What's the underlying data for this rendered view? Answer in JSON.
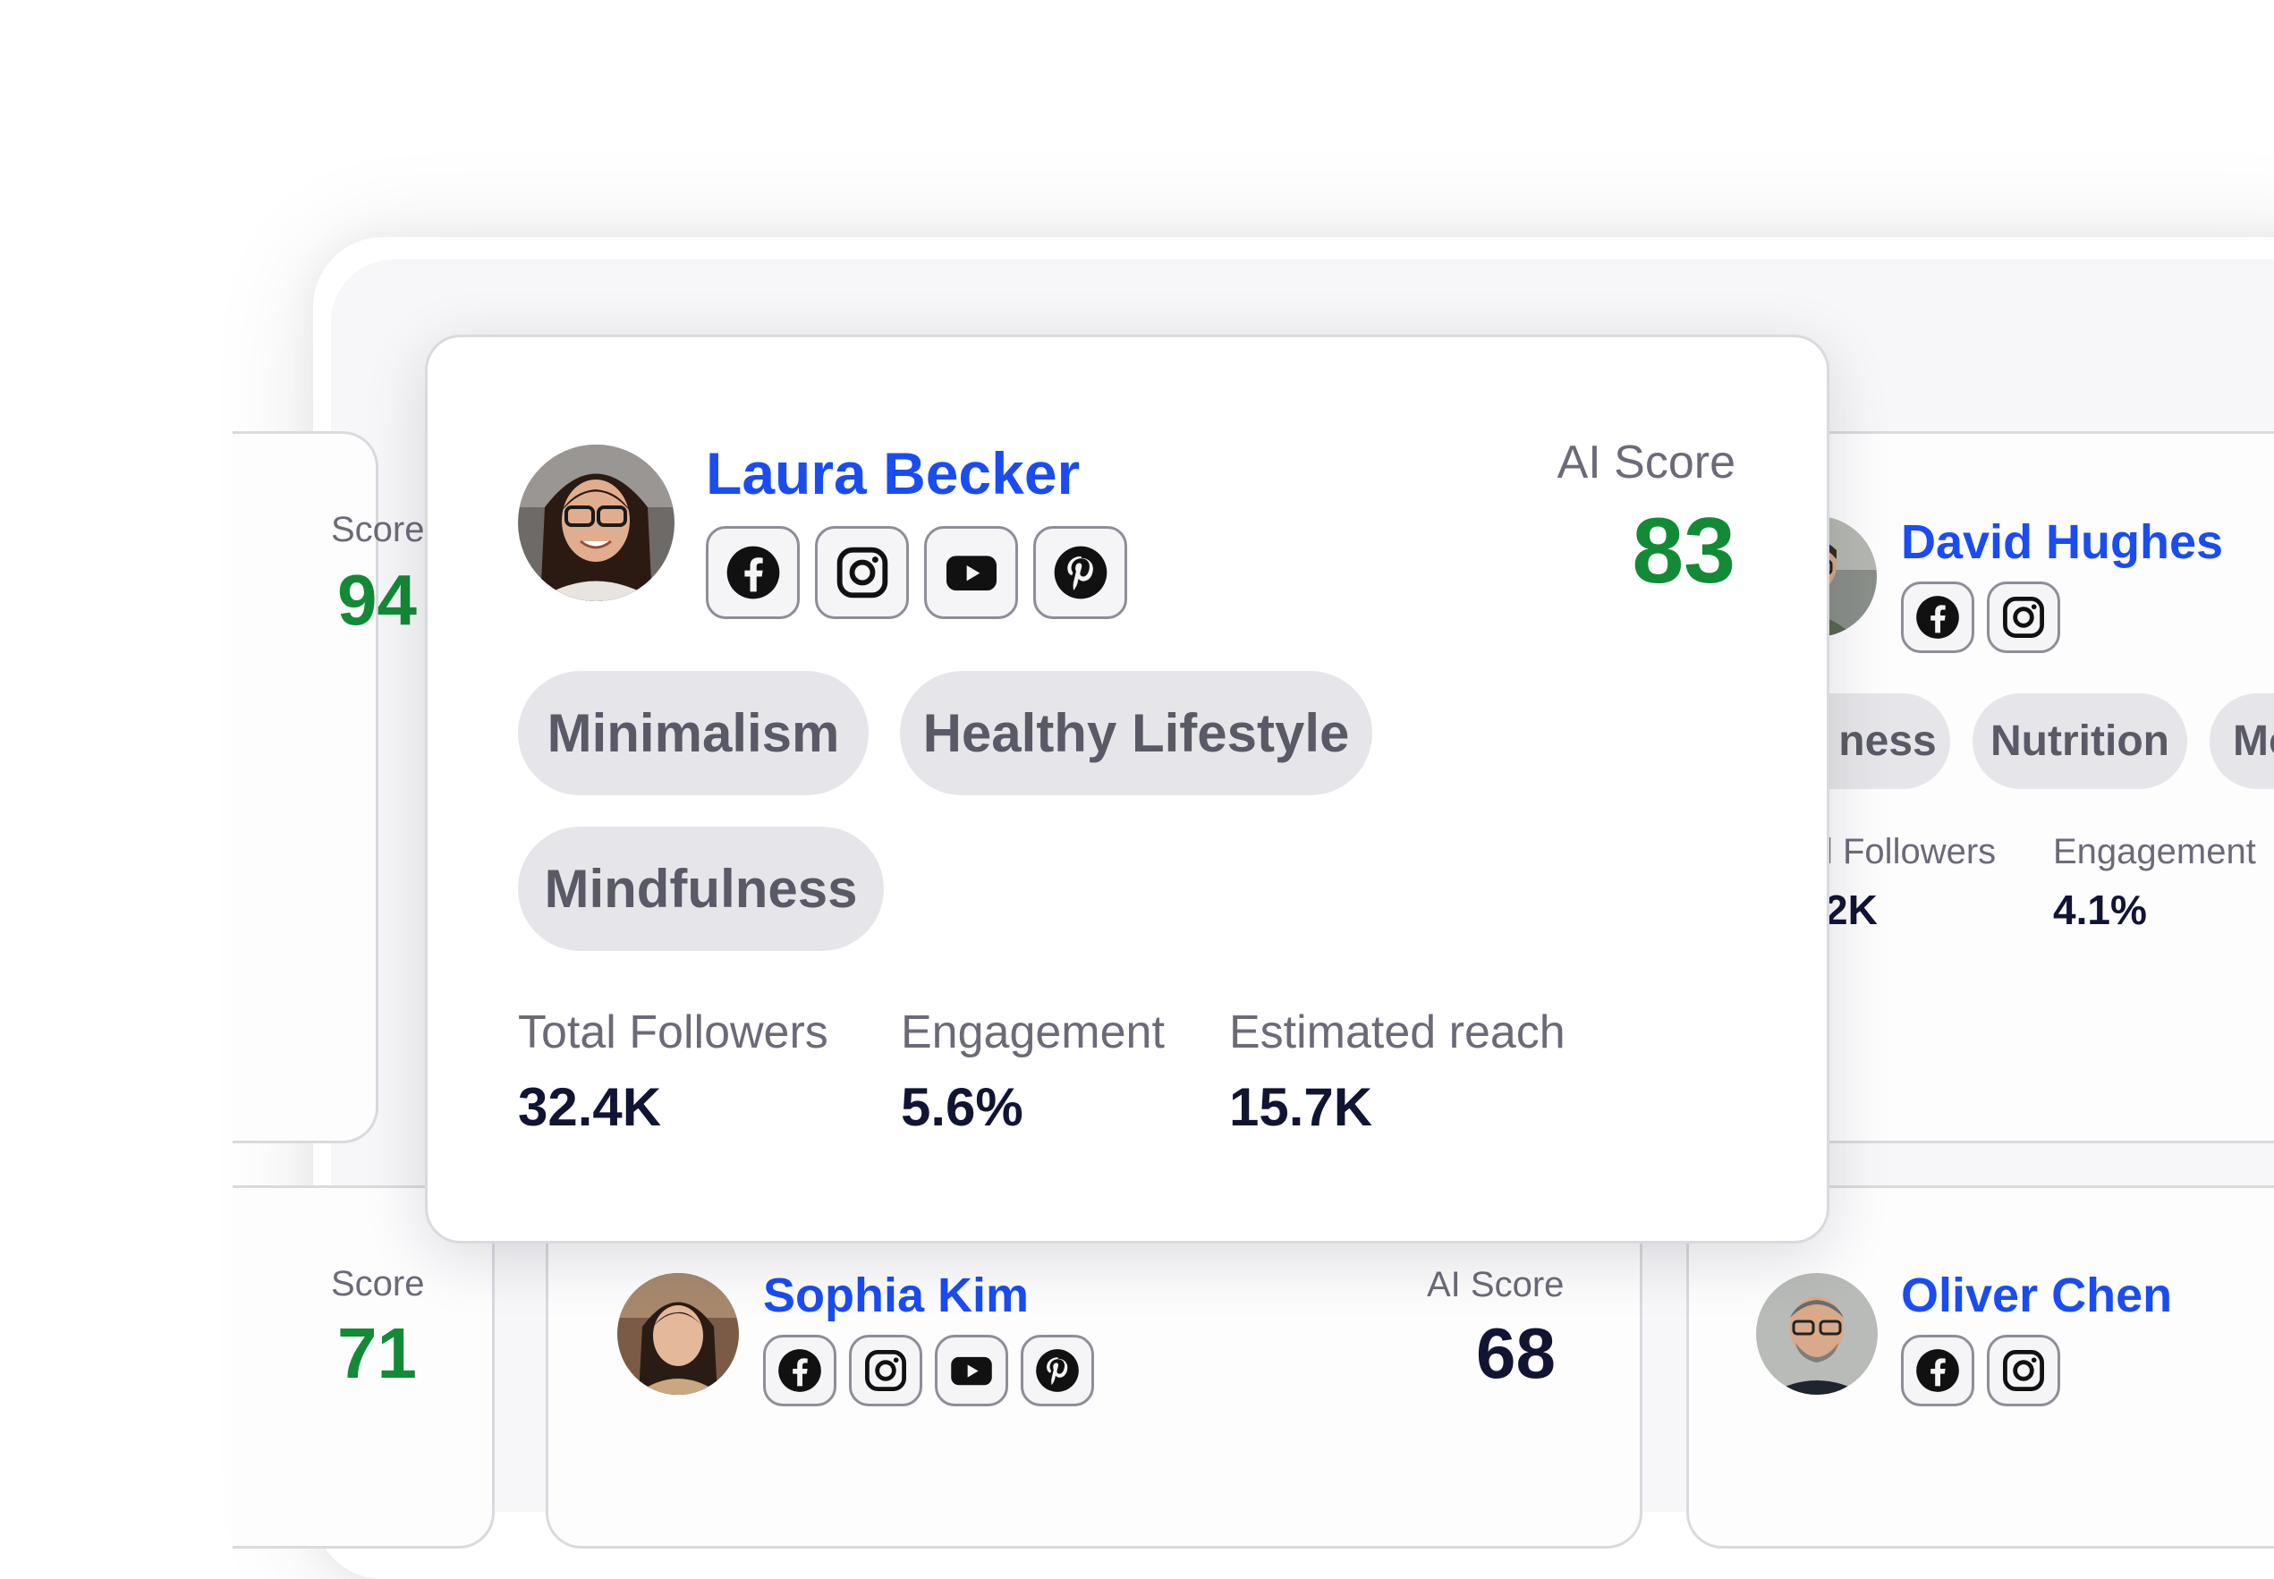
{
  "left_card": {
    "score_label": "Score",
    "score": "94"
  },
  "left_bottom_card": {
    "score_label": "Score",
    "score": "71"
  },
  "featured": {
    "name": "Laura Becker",
    "score_label": "AI Score",
    "score": "83",
    "socials": [
      "facebook-icon",
      "instagram-icon",
      "youtube-icon",
      "pinterest-icon"
    ],
    "tags": [
      "Minimalism",
      "Healthy Lifestyle",
      "Mindfulness"
    ],
    "stats": [
      {
        "label": "Total Followers",
        "value": "32.4K"
      },
      {
        "label": "Engagement",
        "value": "5.6%"
      },
      {
        "label": "Estimated reach",
        "value": "15.7K"
      }
    ]
  },
  "david": {
    "name": "David Hughes",
    "socials": [
      "facebook-icon",
      "instagram-icon"
    ],
    "tags": [
      "ness",
      "Nutrition",
      "Mo"
    ],
    "stats": [
      {
        "label": "l Followers",
        "value": "2K"
      },
      {
        "label": "Engagement",
        "value": "4.1%"
      }
    ]
  },
  "sophia": {
    "name": "Sophia Kim",
    "score_label": "AI Score",
    "score": "68",
    "socials": [
      "facebook-icon",
      "instagram-icon",
      "youtube-icon",
      "pinterest-icon"
    ]
  },
  "oliver": {
    "name": "Oliver Chen",
    "socials": [
      "facebook-icon",
      "instagram-icon"
    ]
  },
  "colors": {
    "brand_blue": "#1a4cf2",
    "score_green": "#138a36",
    "dark_navy": "#111433",
    "tag_bg": "#e6e6ea"
  }
}
